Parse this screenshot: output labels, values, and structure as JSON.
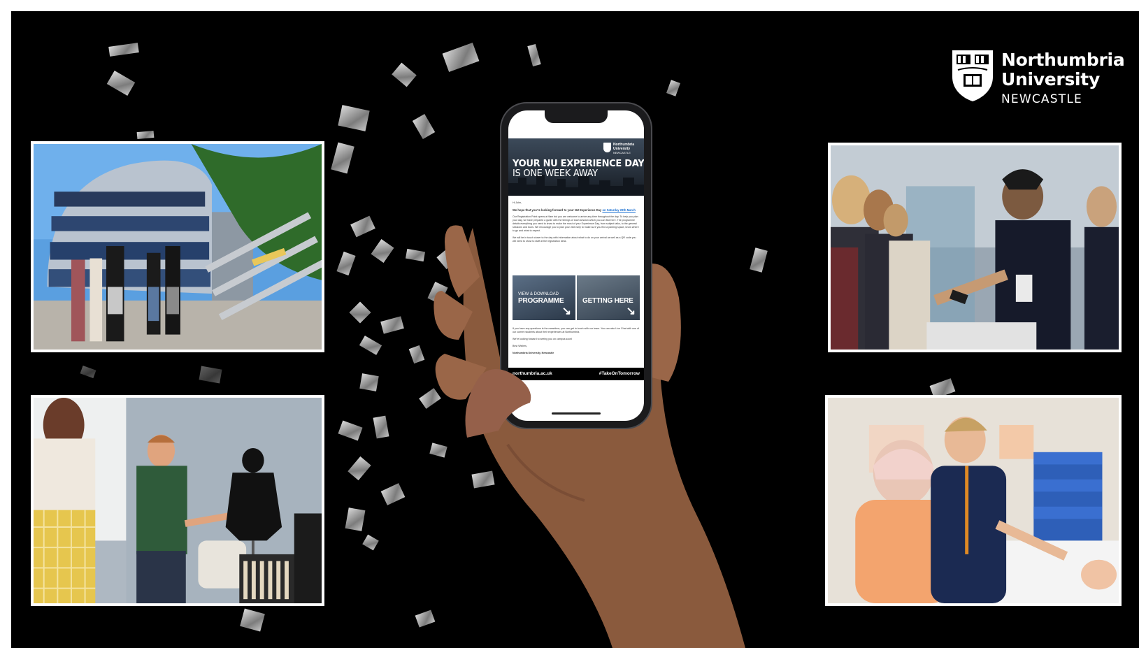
{
  "logo": {
    "line1": "Northumbria",
    "line2": "University",
    "line3": "NEWCASTLE"
  },
  "phone_email": {
    "hero_title_line1": "YOUR NU EXPERIENCE DAY",
    "hero_title_line2": "IS ONE WEEK AWAY",
    "header_logo_line1": "Northumbria",
    "header_logo_line2": "University",
    "header_logo_line3": "NEWCASTLE",
    "greeting": "Hi John,",
    "lead_text": "We hope that you're looking forward to your NU Experience Day",
    "lead_link": "on Saturday 29th March",
    "paragraph1": "Our Registration Point opens at 9am but you are welcome to arrive any time throughout the day. To help you plan your day, we have prepared a guide with the timings of each session which you can find here. The programme details everything you need to know to make the most of your Experience Day, from subject talks, to the general sessions and tours. We encourage you to plan your visit early to make sure you find a parking space, know where to go and what to expect.",
    "paragraph2": "We will be in touch closer to the day with information about what to do on your arrival as well as a QR code you will need to show to staff at the registration desk.",
    "button_left_sub": "VIEW & DOWNLOAD",
    "button_left_main": "PROGRAMME",
    "button_right_main": "GETTING HERE",
    "paragraph3": "If you have any questions in the meantime, you can get in touch with our team. You can also Live Chat with one of our current students about their experiences at Northumbria.",
    "paragraph4": "We're looking forward to seeing you on campus soon!",
    "signoff": "Best Wishes,",
    "signature": "Northumbria University, Newcastle",
    "footer_left": "northumbria.ac.uk",
    "footer_right": "#TakeOnTomorrow"
  },
  "photos": [
    {
      "id": "campus-building",
      "subject": "students outside a glass university building"
    },
    {
      "id": "registration-desk",
      "subject": "staff scanning phones at registration"
    },
    {
      "id": "design-workshop",
      "subject": "lecturer presenting a garment on a mannequin"
    },
    {
      "id": "nursing-skills",
      "subject": "nursing students practising on a manikin"
    }
  ],
  "colors": {
    "background": "#000000",
    "frame": "#ffffff",
    "link": "#1a6fd1"
  }
}
